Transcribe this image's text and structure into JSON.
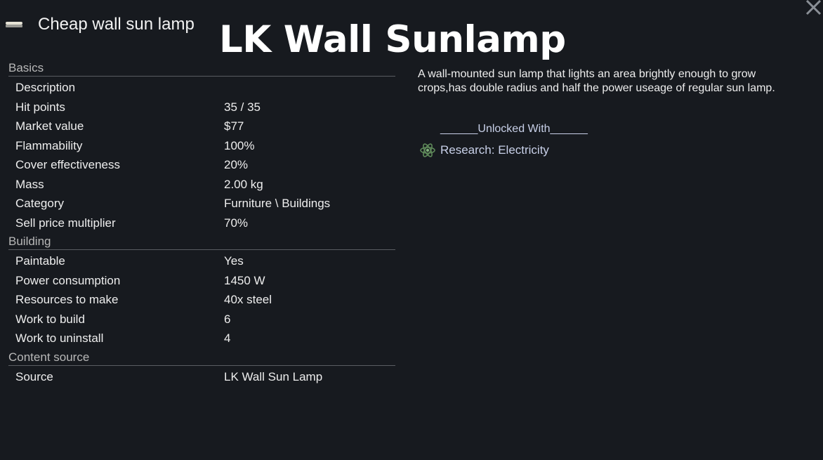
{
  "window": {
    "thing_title": "Cheap wall sun lamp",
    "overlay_title": "LK Wall Sunlamp",
    "close_icon": "close-x-icon",
    "thing_icon": "wall-lamp-icon"
  },
  "stats": {
    "sections": [
      {
        "header": "Basics",
        "rows": [
          {
            "label": "Description",
            "value": ""
          },
          {
            "label": "Hit points",
            "value": "35 / 35"
          },
          {
            "label": "Market value",
            "value": "$77"
          },
          {
            "label": "Flammability",
            "value": "100%"
          },
          {
            "label": "Cover effectiveness",
            "value": "20%"
          },
          {
            "label": "Mass",
            "value": "2.00 kg"
          },
          {
            "label": "Category",
            "value": "Furniture \\ Buildings"
          },
          {
            "label": "Sell price multiplier",
            "value": "70%"
          }
        ]
      },
      {
        "header": "Building",
        "rows": [
          {
            "label": "Paintable",
            "value": "Yes"
          },
          {
            "label": "Power consumption",
            "value": "1450 W"
          },
          {
            "label": "Resources to make",
            "value": "40x steel"
          },
          {
            "label": "Work to build",
            "value": "6"
          },
          {
            "label": "Work to uninstall",
            "value": "4"
          }
        ]
      },
      {
        "header": "Content source",
        "rows": [
          {
            "label": "Source",
            "value": "LK Wall Sun Lamp"
          }
        ]
      }
    ]
  },
  "description": "A wall-mounted sun lamp that lights an area brightly enough to grow crops,has double radius and half the power useage of regular sun lamp.",
  "unlocked_with": {
    "header": "______Unlocked With______",
    "items": [
      {
        "label": "Research: Electricity",
        "icon": "research-atom-icon"
      }
    ]
  },
  "colors": {
    "background": "#171a1f",
    "link_text": "#c8d0e8",
    "section_header": "#b8b8b8"
  }
}
